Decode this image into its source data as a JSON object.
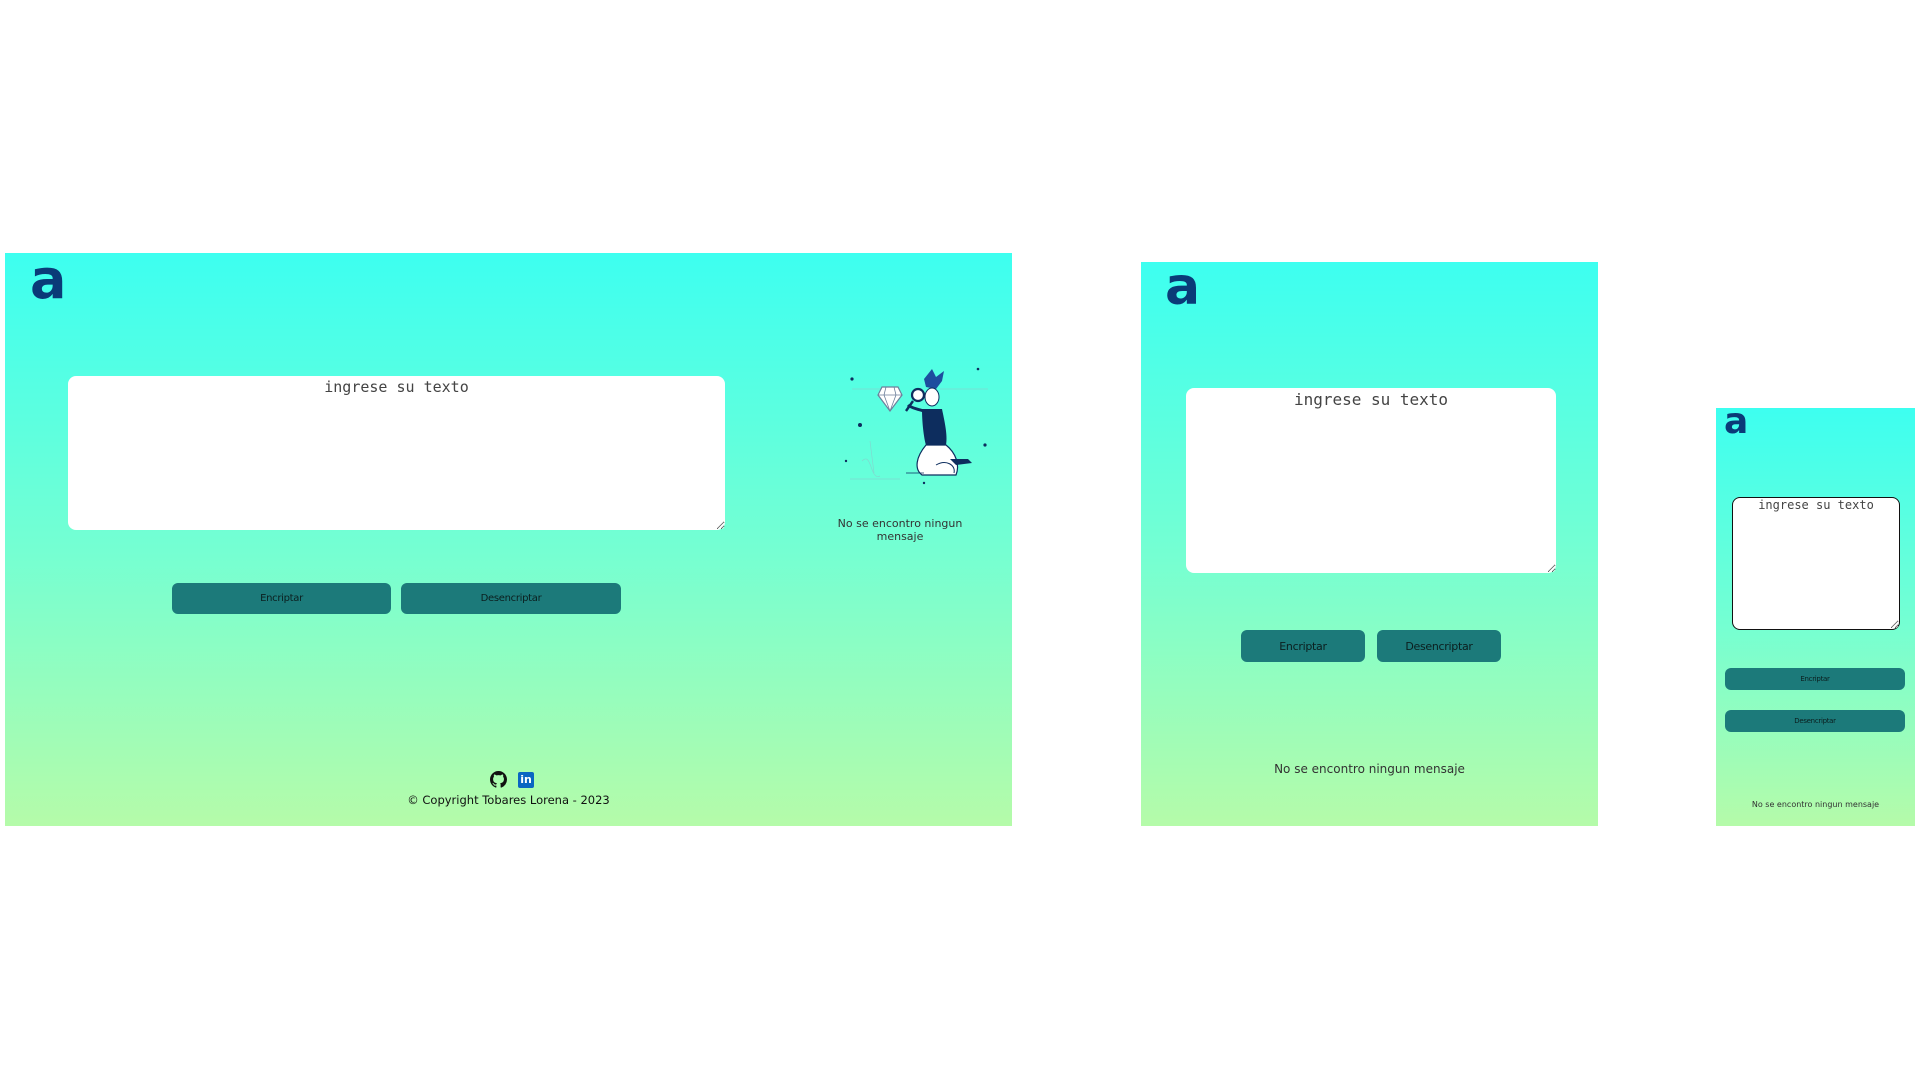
{
  "logo": {
    "glyph": "a",
    "color": "#0a3b78"
  },
  "colors": {
    "gradient_top": "#3dfff0",
    "gradient_bottom": "#b5fba9",
    "button_bg": "#1c7a7a"
  },
  "input": {
    "placeholder": "ingrese su texto"
  },
  "buttons": {
    "encrypt": "Encriptar",
    "decrypt": "Desencriptar"
  },
  "output": {
    "empty_message": "No se encontro ningun mensaje"
  },
  "footer": {
    "copyright": "© Copyright Tobares Lorena - 2023",
    "icons": [
      "github-icon",
      "linkedin-icon"
    ],
    "linkedin_glyph": "in"
  }
}
